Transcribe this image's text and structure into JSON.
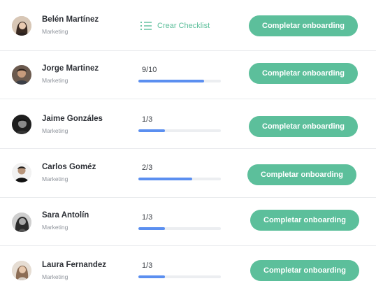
{
  "colors": {
    "accent": "#5cbf9b",
    "progress_fill": "#5b8ff0",
    "progress_track": "#eceef1",
    "divider": "#e9ebee"
  },
  "action_label": "Completar onboarding",
  "employees": [
    {
      "name": "Belén Martínez",
      "department": "Marketing",
      "checklist_link": "Crear Checklist",
      "checklist_icon": "list-icon"
    },
    {
      "name": "Jorge Martinez",
      "department": "Marketing",
      "progress_text": "9/10",
      "progress_fraction": 0.8
    },
    {
      "name": "Jaime Gonzáles",
      "department": "Marketing",
      "progress_text": "1/3",
      "progress_fraction": 0.32
    },
    {
      "name": "Carlos Goméz",
      "department": "Marketing",
      "progress_text": "2/3",
      "progress_fraction": 0.65
    },
    {
      "name": "Sara Antolín",
      "department": "Marketing",
      "progress_text": "1/3",
      "progress_fraction": 0.32
    },
    {
      "name": "Laura Fernandez",
      "department": "Marketing",
      "progress_text": "1/3",
      "progress_fraction": 0.32
    }
  ]
}
